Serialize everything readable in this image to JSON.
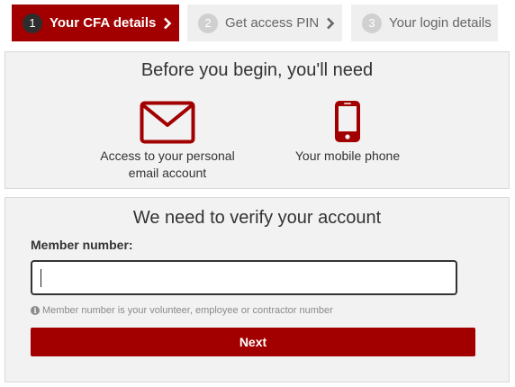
{
  "steps": [
    {
      "number": "1",
      "label": "Your CFA details",
      "active": true
    },
    {
      "number": "2",
      "label": "Get access PIN",
      "active": false
    },
    {
      "number": "3",
      "label": "Your login details",
      "active": false
    }
  ],
  "requirements": {
    "title": "Before you begin, you'll need",
    "email": {
      "icon": "envelope-icon",
      "line1": "Access to your personal",
      "line2": "email account"
    },
    "phone": {
      "icon": "mobile-phone-icon",
      "label": "Your mobile phone"
    }
  },
  "verify": {
    "title": "We need to verify your account",
    "field_label": "Member number:",
    "input_value": "",
    "help_text": "Member number is your volunteer, employee or contractor number",
    "next_label": "Next"
  },
  "colors": {
    "accent": "#a20000",
    "panel_bg": "#f2f2f2",
    "inactive_step_bg": "#efefef"
  }
}
